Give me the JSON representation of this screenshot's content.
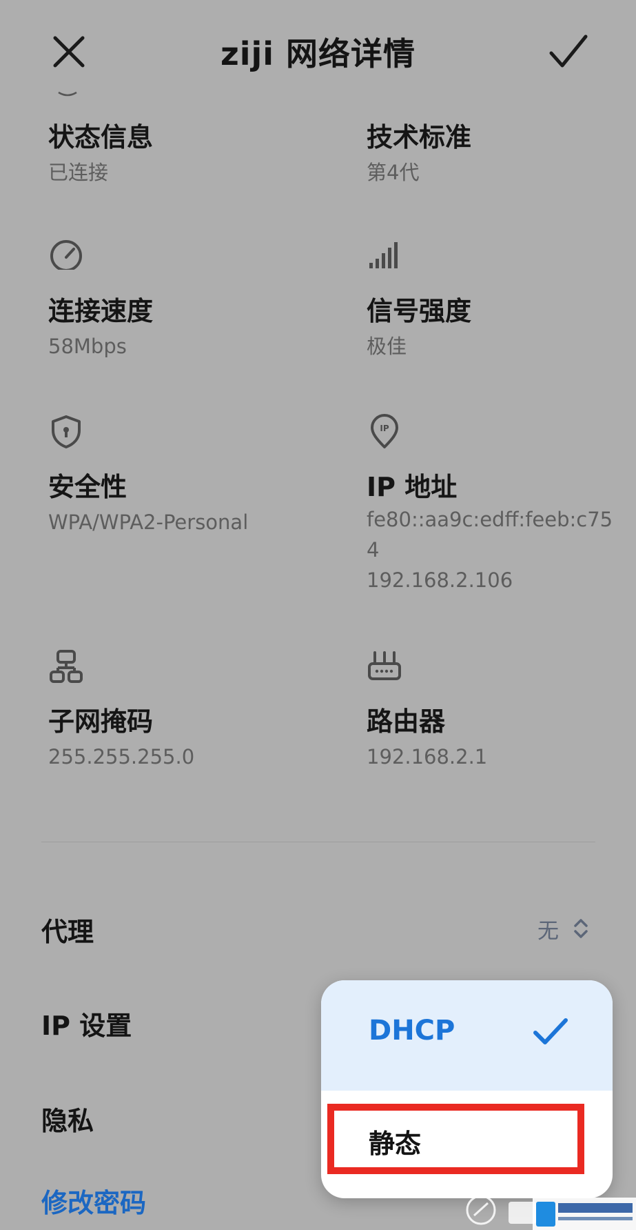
{
  "header": {
    "title": "ziji 网络详情",
    "close_icon": "close-icon",
    "confirm_icon": "check-icon"
  },
  "info_grid": [
    {
      "label": "状态信息",
      "value": "已连接",
      "icon": ""
    },
    {
      "label": "技术标准",
      "value": "第4代",
      "icon": ""
    },
    {
      "label": "连接速度",
      "value": "58Mbps",
      "icon": "speedometer-icon"
    },
    {
      "label": "信号强度",
      "value": "极佳",
      "icon": "signal-bars-icon"
    },
    {
      "label": "安全性",
      "value": "WPA/WPA2-Personal",
      "icon": "shield-icon"
    },
    {
      "label": "IP 地址",
      "value_lines": [
        "fe80::aa9c:edff:feeb:c75",
        "4",
        "192.168.2.106"
      ],
      "icon": "ip-pin-icon"
    },
    {
      "label": "子网掩码",
      "value": "255.255.255.0",
      "icon": "subnet-icon"
    },
    {
      "label": "路由器",
      "value": "192.168.2.1",
      "icon": "router-icon"
    }
  ],
  "settings": {
    "proxy": {
      "label": "代理",
      "value": "无"
    },
    "ip_settings": {
      "label": "IP 设置"
    },
    "privacy": {
      "label": "隐私"
    },
    "change_password": {
      "label": "修改密码"
    }
  },
  "ip_menu": {
    "options": [
      {
        "label": "DHCP",
        "selected": true
      },
      {
        "label": "静态",
        "selected": false
      }
    ]
  },
  "colors": {
    "background": "#aeaeae",
    "accent": "#1c75d8",
    "highlight": "#ea2a22"
  }
}
